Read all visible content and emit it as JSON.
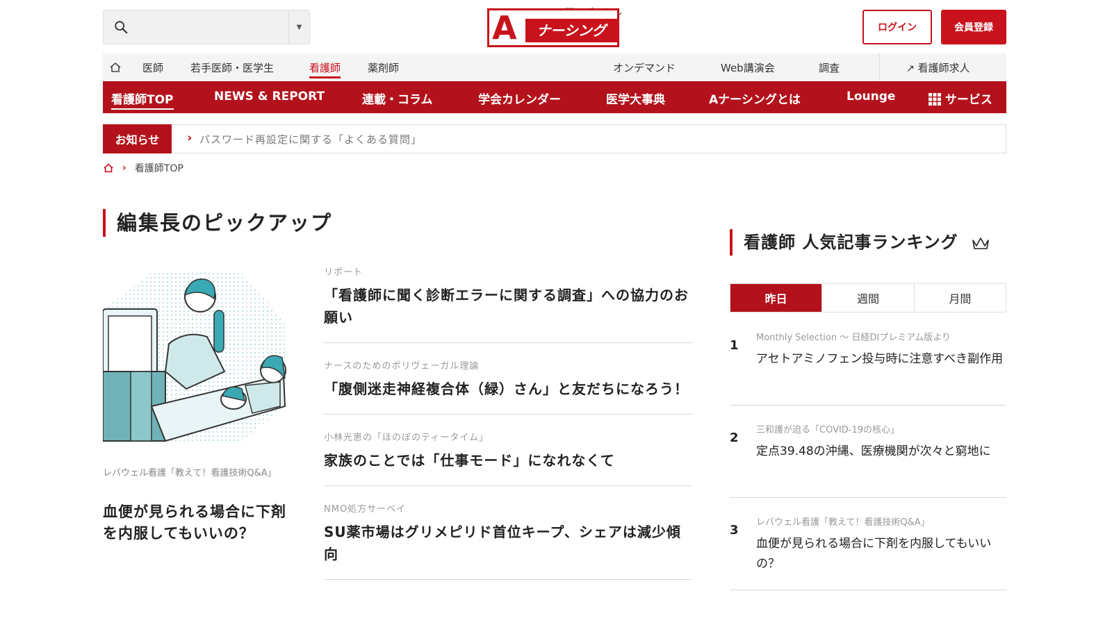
{
  "search": {
    "placeholder": "",
    "value": ""
  },
  "logo": {
    "publisher": "日経メディカル",
    "letter": "A",
    "name": "ナーシング"
  },
  "header": {
    "login": "ログイン",
    "register": "会員登録"
  },
  "topnav": {
    "items": [
      "医師",
      "若手医師・医学生",
      "看護師",
      "薬剤師"
    ],
    "right": [
      "オンデマンド",
      "Web講演会",
      "調査"
    ],
    "jobs": "看護師求人"
  },
  "rednav": {
    "items": [
      "看護師TOP",
      "NEWS & REPORT",
      "連載・コラム",
      "学会カレンダー",
      "医学大事典",
      "Aナーシングとは",
      "Lounge",
      "サービス"
    ]
  },
  "notice": {
    "label": "お知らせ",
    "text": "パスワード再設定に関する「よくある質問」"
  },
  "breadcrumb": {
    "current": "看護師TOP"
  },
  "pickup": {
    "title": "編集長のピックアップ",
    "featured": {
      "category": "レバウェル看護「教えて！看護技術Q&A」",
      "title": "血便が見られる場合に下剤を内服してもいいの？"
    },
    "articles": [
      {
        "category": "リポート",
        "title": "「看護師に聞く診断エラーに関する調査」への協力のお願い"
      },
      {
        "category": "ナースのためのポリヴェーガル理論",
        "title": "「腹側迷走神経複合体（緑）さん」と友だちになろう！"
      },
      {
        "category": "小林光恵の「ほのぼのティータイム」",
        "title": "家族のことでは「仕事モード」になれなくて"
      },
      {
        "category": "NMO処方サーベイ",
        "title": "SU薬市場はグリメピリド首位キープ、シェアは減少傾向"
      }
    ]
  },
  "ranking": {
    "title": "看護師 人気記事ランキング",
    "tabs": [
      "昨日",
      "週間",
      "月間"
    ],
    "items": [
      {
        "rank": "1",
        "category": "Monthly Selection ～ 日経DIプレミアム版より",
        "title": "アセトアミノフェン投与時に注意すべき副作用"
      },
      {
        "rank": "2",
        "category": "三和護が迫る「COVID-19の核心」",
        "title": "定点39.48の沖縄、医療機関が次々と窮地に"
      },
      {
        "rank": "3",
        "category": "レバウェル看護「教えて！看護技術Q&A」",
        "title": "血便が見られる場合に下剤を内服してもいいの？"
      }
    ]
  },
  "colors": {
    "brand": "#c8121c",
    "nav": "#b3121c"
  }
}
